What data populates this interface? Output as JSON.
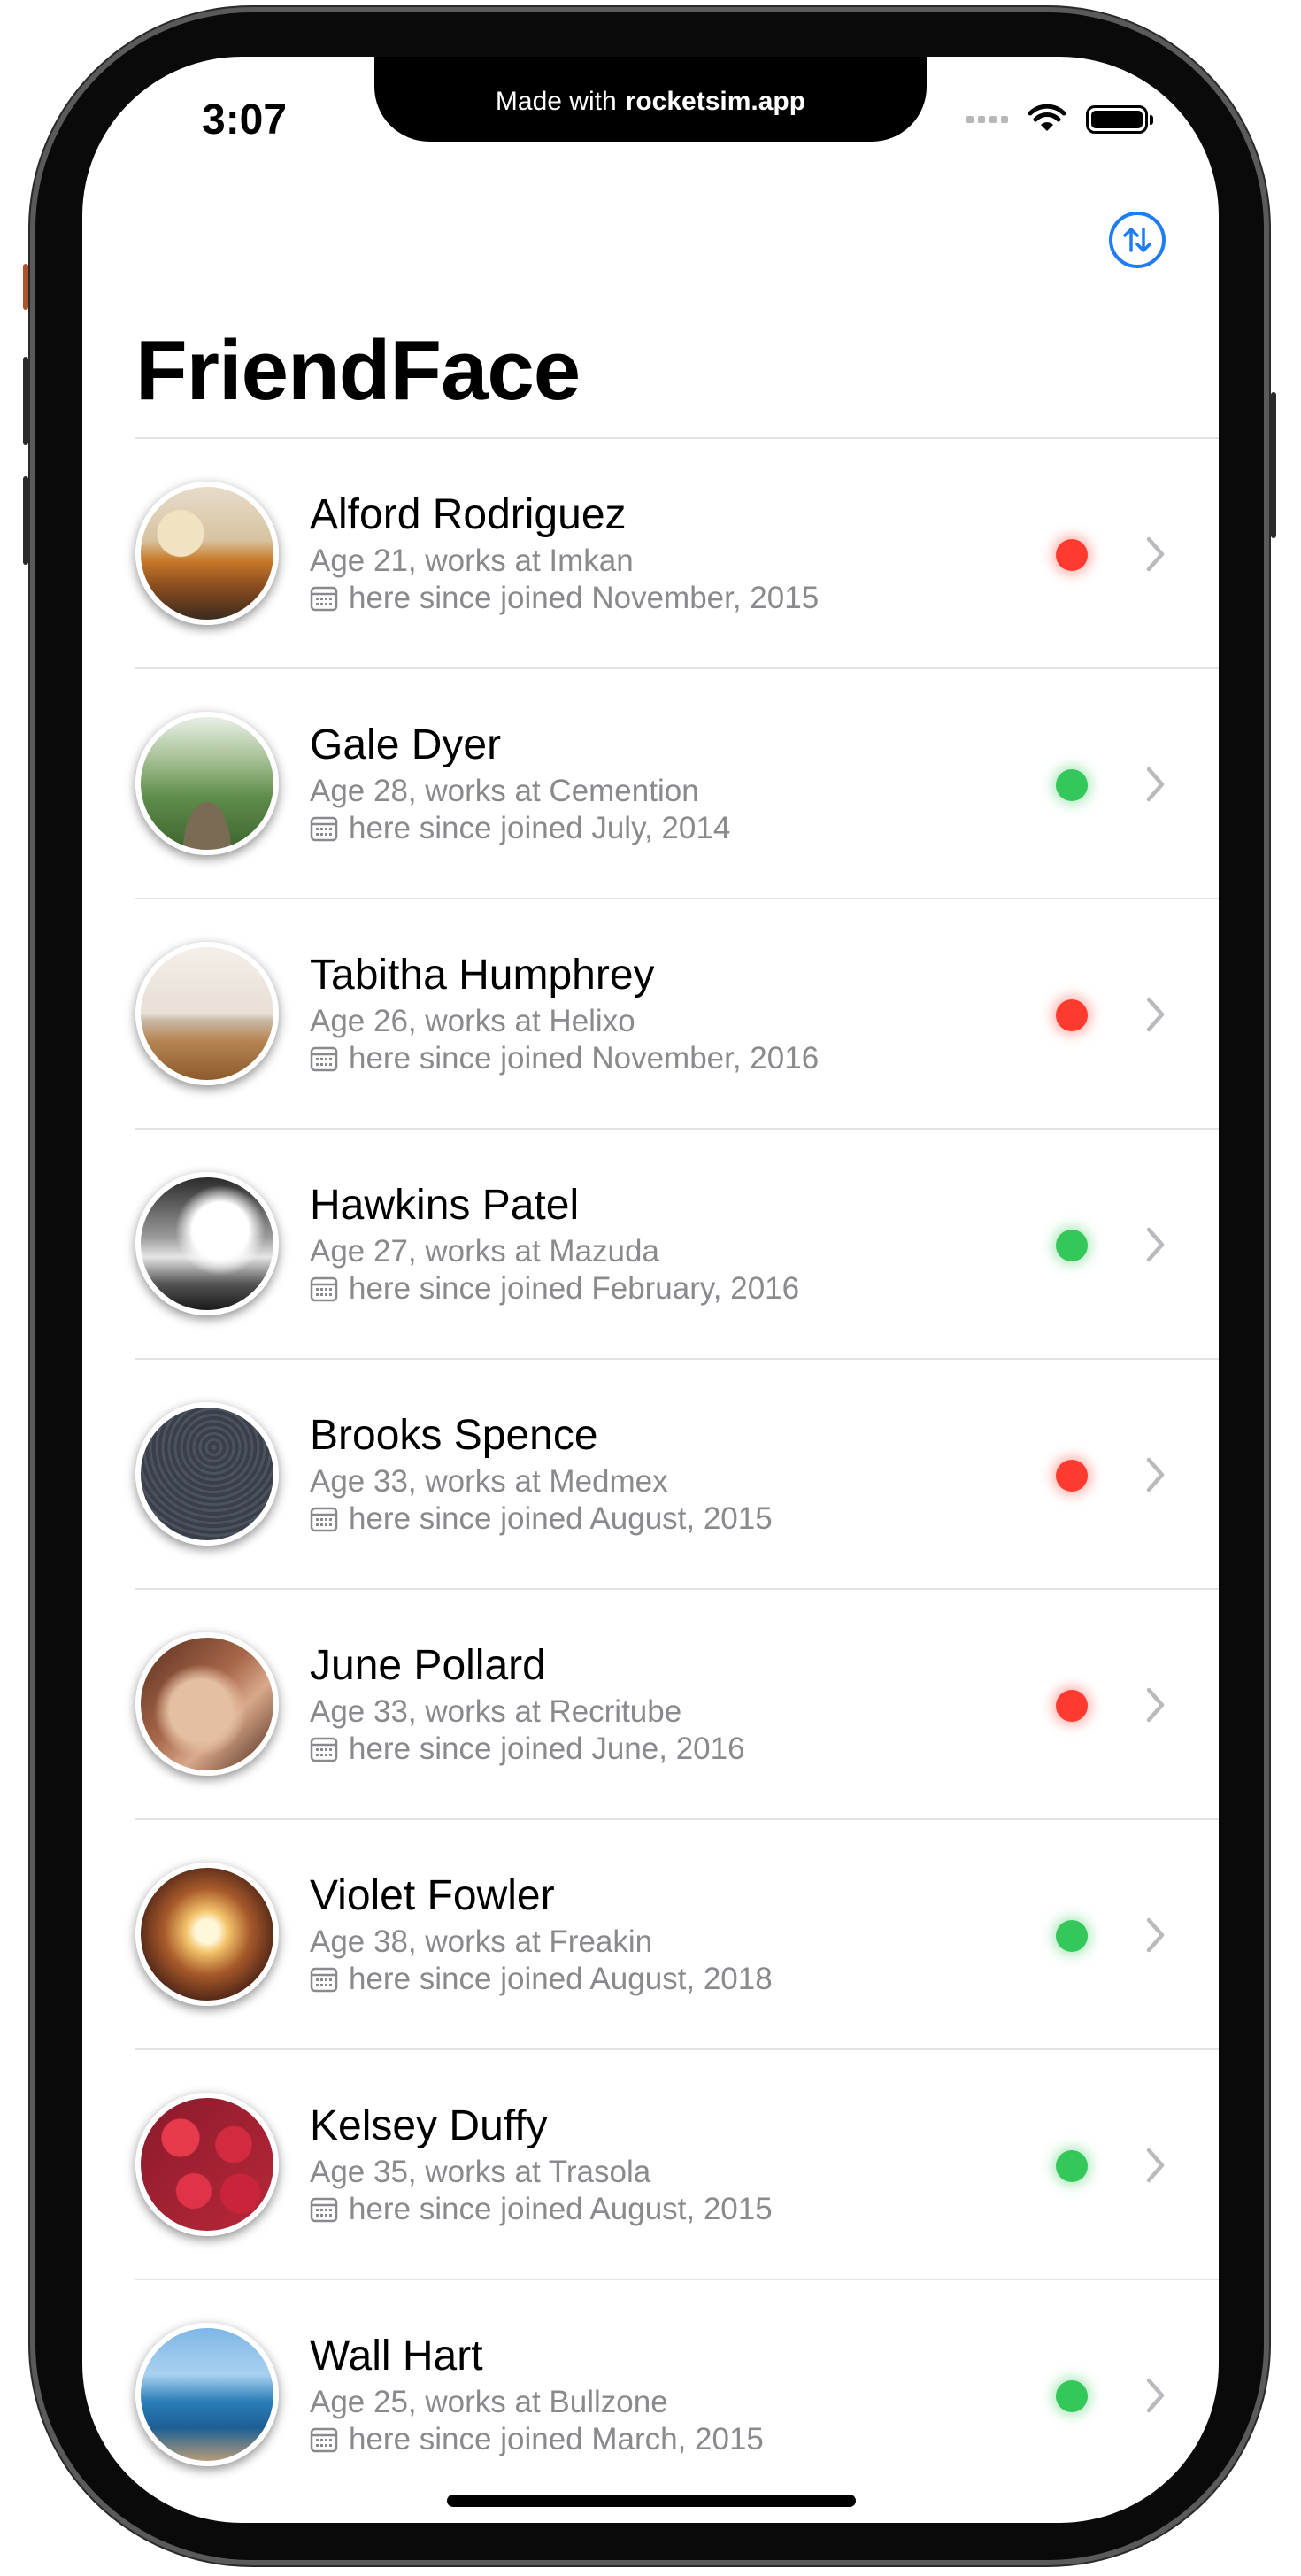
{
  "banner": {
    "prefix": "Made with",
    "brand": "rocketsim.app"
  },
  "status_bar": {
    "time": "3:07"
  },
  "nav": {
    "title": "FriendFace",
    "sort_icon": "arrow-up-down-circle-icon"
  },
  "colors": {
    "accent": "#1e7cf5",
    "active": "#34c759",
    "inactive": "#ff3b30"
  },
  "friends": [
    {
      "name": "Alford Rodriguez",
      "detail": "Age 21, works at Imkan",
      "joined": "here since joined November, 2015",
      "active": false,
      "avatar": "tram-photo"
    },
    {
      "name": "Gale Dyer",
      "detail": "Age 28, works at Cemention",
      "joined": "here since joined July, 2014",
      "active": true,
      "avatar": "forest-path-photo"
    },
    {
      "name": "Tabitha Humphrey",
      "detail": "Age 26, works at Helixo",
      "joined": "here since joined November, 2016",
      "active": false,
      "avatar": "pier-photo"
    },
    {
      "name": "Hawkins Patel",
      "detail": "Age 27, works at Mazuda",
      "joined": "here since joined February, 2016",
      "active": true,
      "avatar": "clouds-bw-photo"
    },
    {
      "name": "Brooks Spence",
      "detail": "Age 33, works at Medmex",
      "joined": "here since joined August, 2015",
      "active": false,
      "avatar": "star-trails-photo"
    },
    {
      "name": "June Pollard",
      "detail": "Age 33, works at Recritube",
      "joined": "here since joined June, 2016",
      "active": false,
      "avatar": "hands-photo"
    },
    {
      "name": "Violet Fowler",
      "detail": "Age 38, works at Freakin",
      "joined": "here since joined August, 2018",
      "active": true,
      "avatar": "dome-sun-photo"
    },
    {
      "name": "Kelsey Duffy",
      "detail": "Age 35, works at Trasola",
      "joined": "here since joined August, 2015",
      "active": true,
      "avatar": "strawberries-photo"
    },
    {
      "name": "Wall Hart",
      "detail": "Age 25, works at Bullzone",
      "joined": "here since joined March, 2015",
      "active": true,
      "avatar": "coastline-photo"
    }
  ]
}
